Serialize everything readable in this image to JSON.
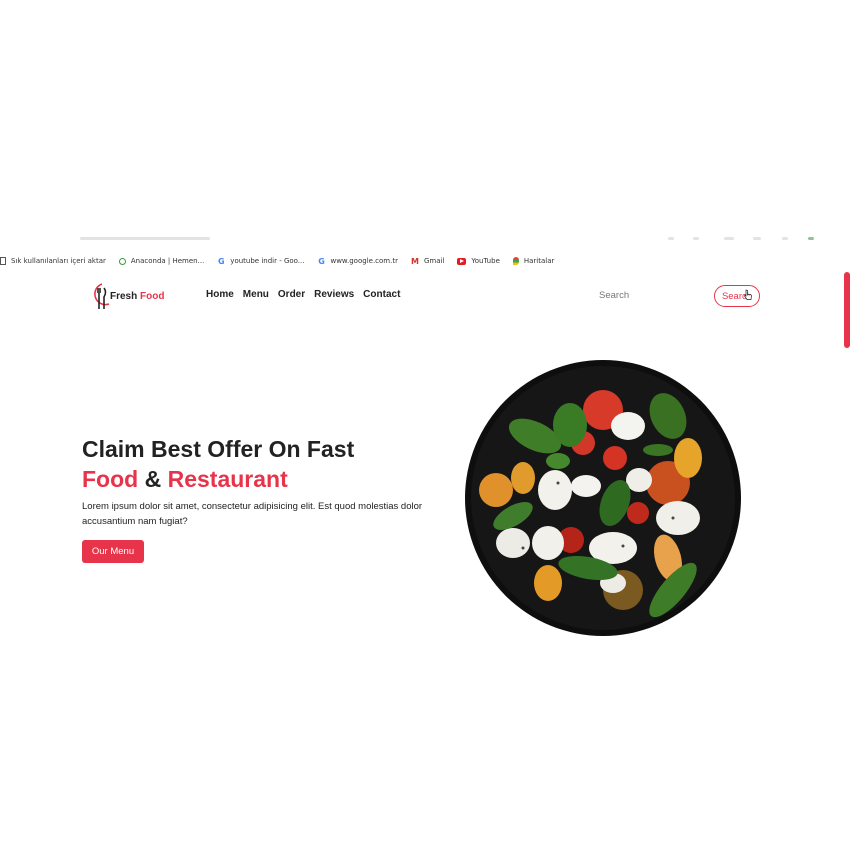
{
  "bookmarks": [
    {
      "icon": "import-icon",
      "label": "Sık kullanılanları içeri aktar"
    },
    {
      "icon": "anaconda-icon",
      "label": "Anaconda | Hemen..."
    },
    {
      "icon": "google-icon",
      "label": "youtube indir - Goo..."
    },
    {
      "icon": "google-icon",
      "label": "www.google.com.tr"
    },
    {
      "icon": "gmail-icon",
      "label": "Gmail"
    },
    {
      "icon": "youtube-icon",
      "label": "YouTube"
    },
    {
      "icon": "maps-icon",
      "label": "Haritalar"
    }
  ],
  "header": {
    "logo": {
      "word1": "Fresh",
      "word2": "Food"
    },
    "nav": [
      "Home",
      "Menu",
      "Order",
      "Reviews",
      "Contact"
    ],
    "search": {
      "placeholder": "Search",
      "button_label": "Search"
    }
  },
  "hero": {
    "title_line1": "Claim Best Offer On Fast",
    "title_word_food": "Food",
    "title_amp": "&",
    "title_word_restaurant": "Restaurant",
    "description": "Lorem ipsum dolor sit amet, consectetur adipisicing elit. Est quod molestias dolor accusantium nam fugiat?",
    "cta_label": "Our Menu"
  },
  "colors": {
    "accent": "#e8344b",
    "text": "#222222",
    "plate": "#111111"
  }
}
